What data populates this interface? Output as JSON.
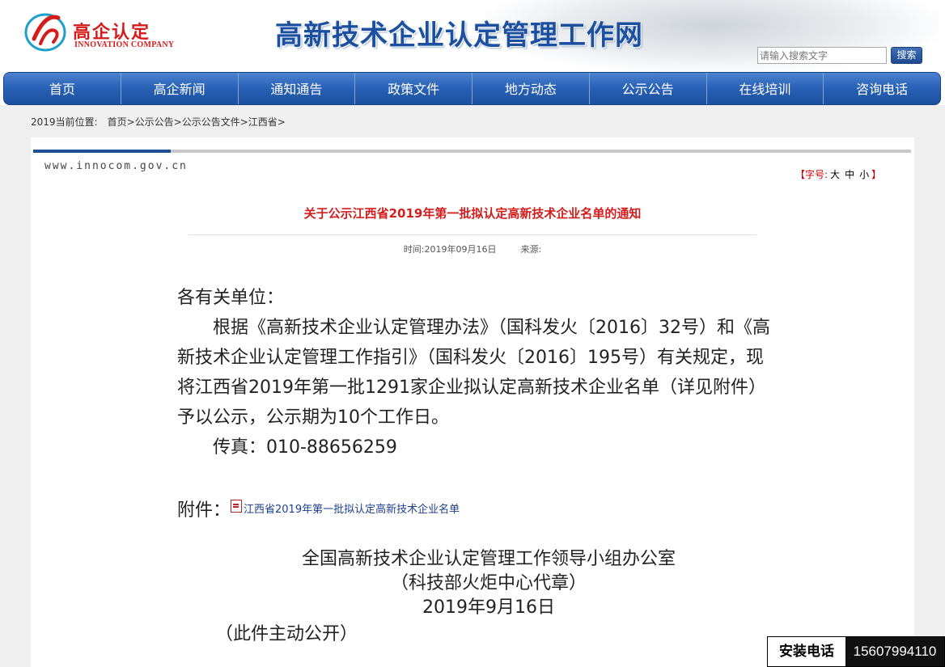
{
  "header": {
    "logo_cn": "高企认定",
    "logo_en": "INNOVATION COMPANY",
    "site_title": "高新技术企业认定管理工作网",
    "search_placeholder": "请输入搜索文字",
    "search_button": "搜索"
  },
  "nav": {
    "items": [
      "首页",
      "高企新闻",
      "通知通告",
      "政策文件",
      "地方动态",
      "公示公告",
      "在线培训",
      "咨询电话"
    ]
  },
  "breadcrumb": {
    "label": "2019当前位置:",
    "path": "首页>公示公告>公示公告文件>江西省>"
  },
  "content": {
    "domain": "www.innocom.gov.cn",
    "font_size_label": "【字号:",
    "font_sizes": [
      "大",
      "中",
      "小"
    ],
    "font_size_end": "】",
    "title": "关于公示江西省2019年第一批拟认定高新技术企业名单的通知",
    "time_label": "时间:2019年09月16日",
    "source_label": "来源:",
    "salutation": "各有关单位：",
    "paragraph": "根据《高新技术企业认定管理办法》（国科发火〔2016〕32号）和《高新技术企业认定管理工作指引》（国科发火〔2016〕195号）有关规定，现将江西省2019年第一批1291家企业拟认定高新技术企业名单（详见附件）予以公示，公示期为10个工作日。",
    "fax": "传真：010-88656259",
    "attachment_label": "附件：",
    "attachment_link": "江西省2019年第一批拟认定高新技术企业名单",
    "signature_org": "全国高新技术企业认定管理工作领导小组办公室",
    "signature_seal": "（科技部火炬中心代章）",
    "signature_date": "2019年9月16日",
    "open_note": "（此件主动公开）"
  },
  "float_phone": {
    "label": "安装电话",
    "number": "15607994110"
  },
  "colors": {
    "nav_blue": "#2a63b8",
    "title_red": "#d31d1d",
    "site_title_blue": "#1b4fa0"
  }
}
